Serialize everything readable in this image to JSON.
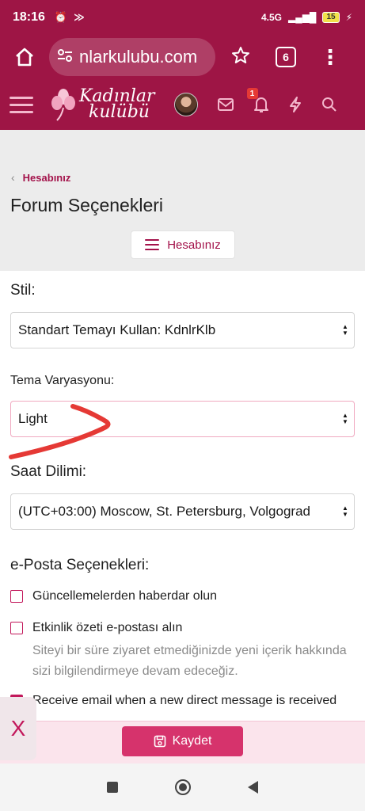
{
  "status": {
    "time": "18:16",
    "icons": [
      "alarm-off-icon",
      "data-saver-icon"
    ],
    "network": "4.5G",
    "battery": "15"
  },
  "browser": {
    "url": "nlarkulubu.com",
    "tab_count": "6"
  },
  "site": {
    "logo_line1": "Kadınlar",
    "logo_line2": "kulübü",
    "alert_count": "1"
  },
  "breadcrumb": {
    "label": "Hesabınız"
  },
  "page": {
    "title": "Forum Seçenekleri",
    "account_button": "Hesabınız"
  },
  "form": {
    "style_label": "Stil:",
    "style_value": "Standart Temayı Kullan: KdnlrKlb",
    "variation_label": "Tema Varyasyonu:",
    "variation_value": "Light",
    "timezone_label": "Saat Dilimi:",
    "timezone_value": "(UTC+03:00) Moscow, St. Petersburg, Volgograd",
    "email_section_label": "e-Posta Seçenekleri:",
    "options": [
      {
        "label": "Güncellemelerden haberdar olun",
        "checked": false
      },
      {
        "label": "Etkinlik özeti e-postası alın",
        "checked": false,
        "hint": "Siteyi bir süre ziyaret etmediğinizde yeni içerik hakkında sizi bilgilendirmeye devam edeceğiz."
      },
      {
        "label": "Receive email when a new direct message is received",
        "checked": true
      }
    ]
  },
  "footer": {
    "close_label": "X",
    "save_label": "Kaydet"
  },
  "colors": {
    "brand": "#9e1545",
    "accent": "#d6336c",
    "link": "#a3124a",
    "annotation": "#e53935"
  }
}
